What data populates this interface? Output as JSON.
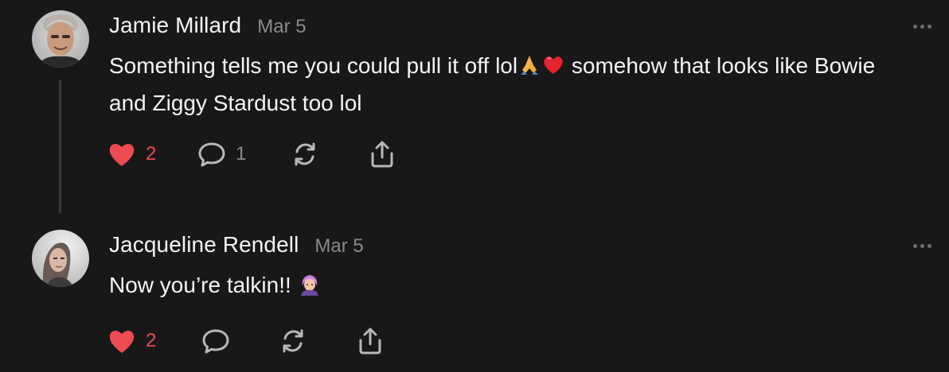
{
  "colors": {
    "background": "#181818",
    "text": "#f3f5f7",
    "muted": "#8a8a8a",
    "like": "#ee4a52"
  },
  "posts": [
    {
      "author": "Jamie Millard",
      "date": "Mar 5",
      "text_parts": [
        "Something tells me you could pull it off lol",
        " somehow that looks like Bowie and Ziggy Stardust too lol"
      ],
      "emojis": [
        "folded-hands",
        "red-heart"
      ],
      "likes": "2",
      "liked": true,
      "replies": "1"
    },
    {
      "author": "Jacqueline Rendell",
      "date": "Mar 5",
      "text_parts": [
        "Now you’re talkin!! "
      ],
      "emojis": [
        "purple-haired-person"
      ],
      "likes": "2",
      "liked": true,
      "replies": ""
    }
  ]
}
